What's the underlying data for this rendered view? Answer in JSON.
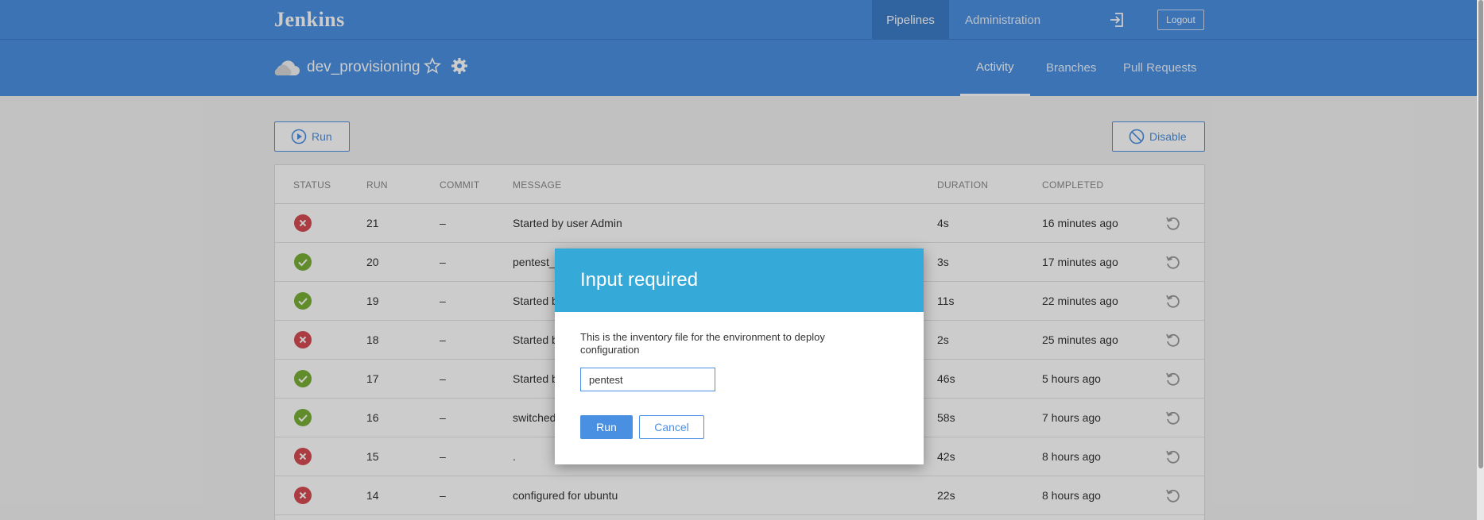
{
  "app": {
    "logo": "Jenkins"
  },
  "topnav": {
    "pipelines": "Pipelines",
    "administration": "Administration",
    "logout": "Logout"
  },
  "pipeline": {
    "name": "dev_provisioning"
  },
  "tabs": [
    {
      "label": "Activity",
      "active": true
    },
    {
      "label": "Branches",
      "active": false
    },
    {
      "label": "Pull Requests",
      "active": false
    }
  ],
  "actions": {
    "run": "Run",
    "disable": "Disable"
  },
  "table": {
    "columns": [
      "STATUS",
      "RUN",
      "COMMIT",
      "MESSAGE",
      "DURATION",
      "COMPLETED"
    ],
    "rows": [
      {
        "status": "failure",
        "run": "21",
        "commit": "–",
        "message": "Started by user Admin",
        "duration": "4s",
        "completed": "16 minutes ago"
      },
      {
        "status": "success",
        "run": "20",
        "commit": "–",
        "message": "pentest_",
        "duration": "3s",
        "completed": "17 minutes ago"
      },
      {
        "status": "success",
        "run": "19",
        "commit": "–",
        "message": "Started b",
        "duration": "11s",
        "completed": "22 minutes ago"
      },
      {
        "status": "failure",
        "run": "18",
        "commit": "–",
        "message": "Started b",
        "duration": "2s",
        "completed": "25 minutes ago"
      },
      {
        "status": "success",
        "run": "17",
        "commit": "–",
        "message": "Started b",
        "duration": "46s",
        "completed": "5 hours ago"
      },
      {
        "status": "success",
        "run": "16",
        "commit": "–",
        "message": "switched",
        "duration": "58s",
        "completed": "7 hours ago"
      },
      {
        "status": "failure",
        "run": "15",
        "commit": "–",
        "message": ".",
        "duration": "42s",
        "completed": "8 hours ago"
      },
      {
        "status": "failure",
        "run": "14",
        "commit": "–",
        "message": "configured for ubuntu",
        "duration": "22s",
        "completed": "8 hours ago"
      }
    ]
  },
  "dialog": {
    "title": "Input required",
    "message": "This is the inventory file for the environment to deploy configuration",
    "input_value": "pentest",
    "run": "Run",
    "cancel": "Cancel"
  },
  "colors": {
    "primary": "#4a90e2",
    "dialog_header": "#35aad9",
    "success": "#78b037",
    "failure": "#d54c53"
  }
}
